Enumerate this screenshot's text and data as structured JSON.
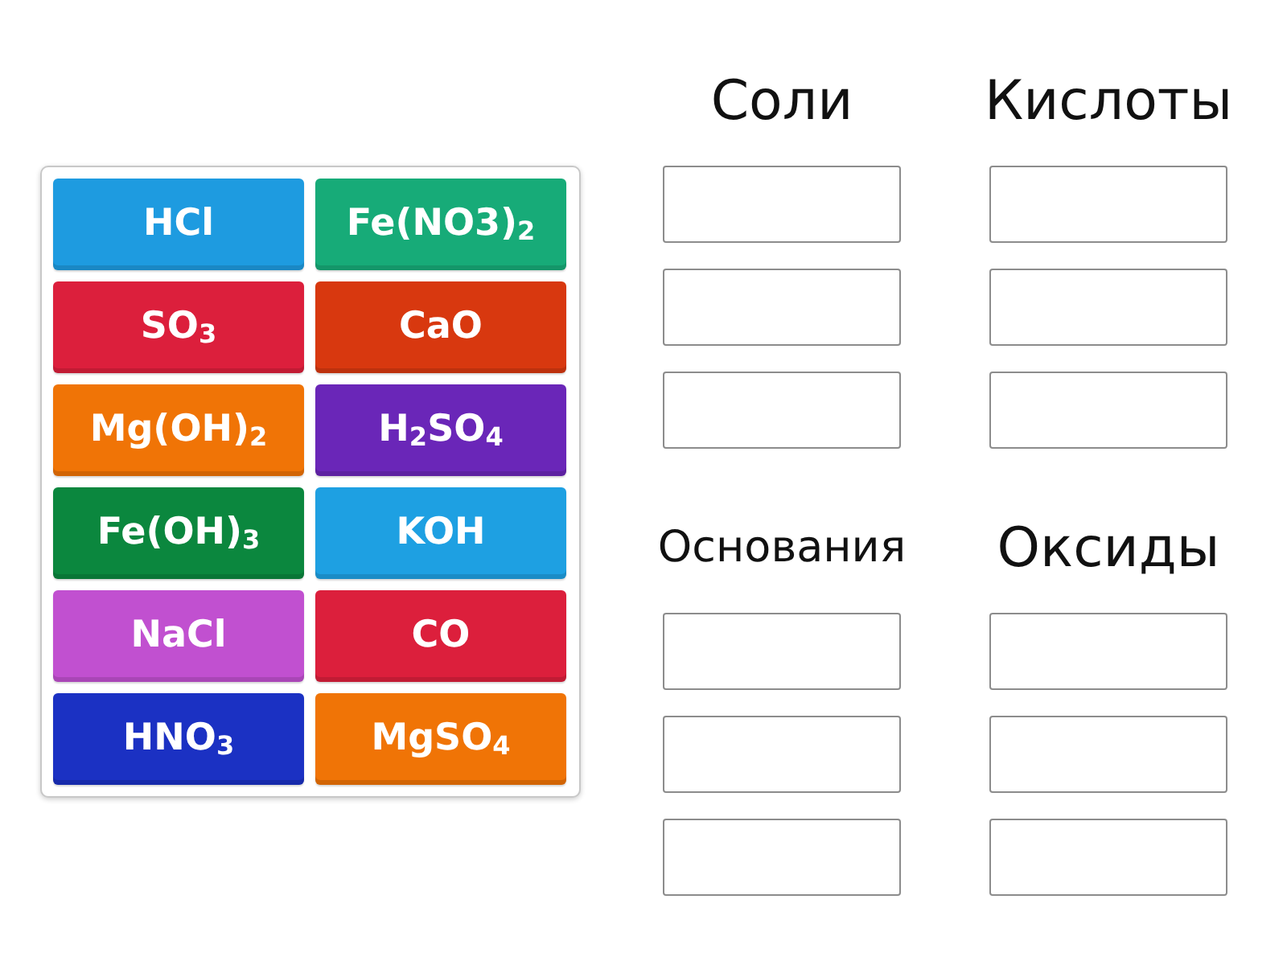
{
  "tiles": [
    {
      "label": "HCl",
      "color": "#1e9be0"
    },
    {
      "label": "Fe(NO3)$_{2}$",
      "color": "#17ab78"
    },
    {
      "label": "SO$_{3}$",
      "color": "#dc1f3c"
    },
    {
      "label": "CaO",
      "color": "#d8380f"
    },
    {
      "label": "Mg(OH)$_{2}$",
      "color": "#f07406"
    },
    {
      "label": "H$_{2}$SO$_{4}$",
      "color": "#6a26b8"
    },
    {
      "label": "Fe(OH)$_{3}$",
      "color": "#0b873e"
    },
    {
      "label": "KOH",
      "color": "#1ea0e2"
    },
    {
      "label": "NaCl",
      "color": "#c150d0"
    },
    {
      "label": "CO",
      "color": "#dc1f3c"
    },
    {
      "label": "HNO$_{3}$",
      "color": "#1b31c3"
    },
    {
      "label": "MgSO$_{4}$",
      "color": "#f07406"
    }
  ],
  "groups": [
    {
      "title": "Соли",
      "slots": [
        {
          "filled": false
        },
        {
          "filled": false
        },
        {
          "filled": false
        }
      ]
    },
    {
      "title": "Кислоты",
      "slots": [
        {
          "filled": false
        },
        {
          "filled": false
        },
        {
          "filled": false
        }
      ]
    },
    {
      "title": "Основания",
      "slots": [
        {
          "filled": false
        },
        {
          "filled": false
        },
        {
          "filled": false
        }
      ]
    },
    {
      "title": "Оксиды",
      "slots": [
        {
          "filled": false
        },
        {
          "filled": false
        },
        {
          "filled": false
        }
      ]
    }
  ]
}
